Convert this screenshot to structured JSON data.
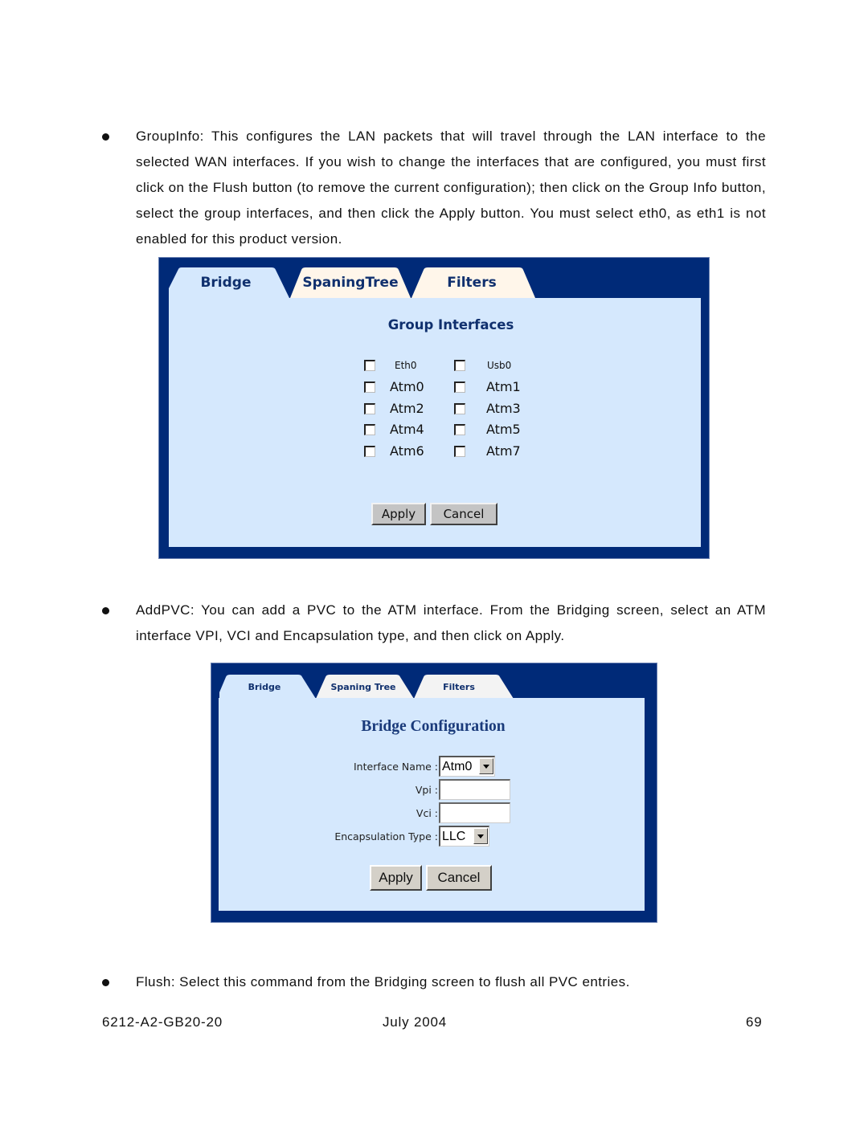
{
  "paragraphs": {
    "group_info": "GroupInfo: This configures the LAN packets that will travel through the LAN interface to the selected WAN interfaces. If you wish to change the interfaces that are configured, you must first click on the Flush button (to remove the current configuration); then click on the Group Info button, select the group interfaces, and then click the Apply button. You must select eth0, as eth1 is not enabled for this product version.",
    "add_pvc": "AddPVC: You can add a PVC to the ATM interface.  From the Bridging screen, select an ATM interface VPI, VCI and Encapsulation type, and then click on Apply.",
    "flush": "Flush: Select this command from the Bridging screen to flush all PVC entries."
  },
  "figure1": {
    "tabs": [
      {
        "label": "Bridge",
        "active": true
      },
      {
        "label": "SpaningTree",
        "active": false
      },
      {
        "label": "Filters",
        "active": false
      }
    ],
    "title": "Group Interfaces",
    "interfaces": [
      {
        "label": "Eth0",
        "checked": false
      },
      {
        "label": "Usb0",
        "checked": false
      },
      {
        "label": "Atm0",
        "checked": false
      },
      {
        "label": "Atm1",
        "checked": false
      },
      {
        "label": "Atm2",
        "checked": false
      },
      {
        "label": "Atm3",
        "checked": false
      },
      {
        "label": "Atm4",
        "checked": false
      },
      {
        "label": "Atm5",
        "checked": false
      },
      {
        "label": "Atm6",
        "checked": false
      },
      {
        "label": "Atm7",
        "checked": false
      }
    ],
    "apply_label": "Apply",
    "cancel_label": "Cancel"
  },
  "figure2": {
    "tabs": [
      {
        "label": "Bridge",
        "active": true
      },
      {
        "label": "Spaning Tree",
        "active": false
      },
      {
        "label": "Filters",
        "active": false
      }
    ],
    "title": "Bridge Configuration",
    "fields": {
      "interface_name": {
        "label": "Interface Name :",
        "value": "Atm0"
      },
      "vpi": {
        "label": "Vpi :",
        "value": ""
      },
      "vci": {
        "label": "Vci :",
        "value": ""
      },
      "encapsulation_type": {
        "label": "Encapsulation Type :",
        "value": "LLC"
      }
    },
    "apply_label": "Apply",
    "cancel_label": "Cancel"
  },
  "colors": {
    "frame_navy": "#002a78",
    "panel_blue": "#d5e8fd",
    "tab_active": "#d5e8fd",
    "tab_inactive_1": "#fff6ea",
    "tab_inactive_2": "#f3f3f3",
    "tab_text": "#10306e"
  },
  "footer": {
    "doc_number": "6212-A2-GB20-20",
    "date": "July 2004",
    "page_number": "69"
  }
}
